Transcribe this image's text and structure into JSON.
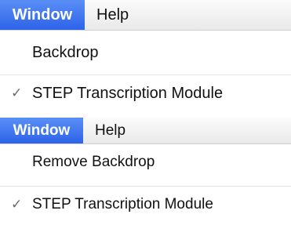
{
  "top_menu": {
    "menubar": {
      "active_menu_label": "Window",
      "other_menu_label": "Help"
    },
    "items": [
      {
        "label": "Backdrop",
        "checked": false
      },
      {
        "label": "STEP Transcription Module",
        "checked": true,
        "check_glyph": "✓"
      }
    ]
  },
  "bottom_menu": {
    "menubar": {
      "active_menu_label": "Window",
      "other_menu_label": "Help"
    },
    "items": [
      {
        "label": "Remove Backdrop",
        "checked": false
      },
      {
        "label": "STEP Transcription Module",
        "checked": true,
        "check_glyph": "✓"
      }
    ]
  },
  "colors": {
    "menu_highlight": "#3d74ee",
    "menu_highlight_text": "#ffffff",
    "menu_text": "#111111",
    "checkmark": "#6a6a6a",
    "menubar_background": "#f2f2f2"
  },
  "icons": {
    "checkmark": "checkmark-icon"
  }
}
